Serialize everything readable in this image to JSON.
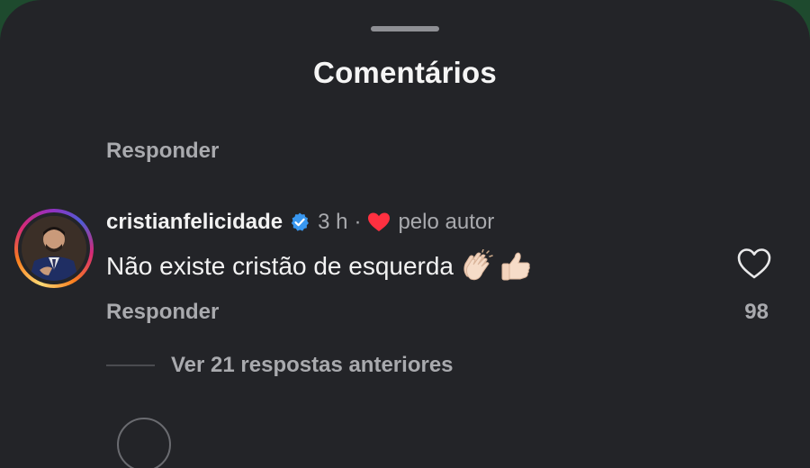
{
  "sheet": {
    "title": "Comentários"
  },
  "previous_comment": {
    "reply_label": "Responder"
  },
  "comment": {
    "username": "cristianfelicidade",
    "verified": true,
    "time": "3 h",
    "separator": "·",
    "liked_by_author_label": "pelo autor",
    "text": "Não existe cristão de esquerda",
    "emojis": [
      "clapping-hands-emoji",
      "thumbs-up-emoji"
    ],
    "reply_label": "Responder",
    "like_count": "98",
    "view_replies_label": "Ver 21 respostas anteriores"
  },
  "colors": {
    "background": "#232428",
    "primary_text": "#f2f2f2",
    "secondary_text": "#a9aaae",
    "verified_blue": "#3897f0",
    "heart_red": "#ff3040"
  }
}
